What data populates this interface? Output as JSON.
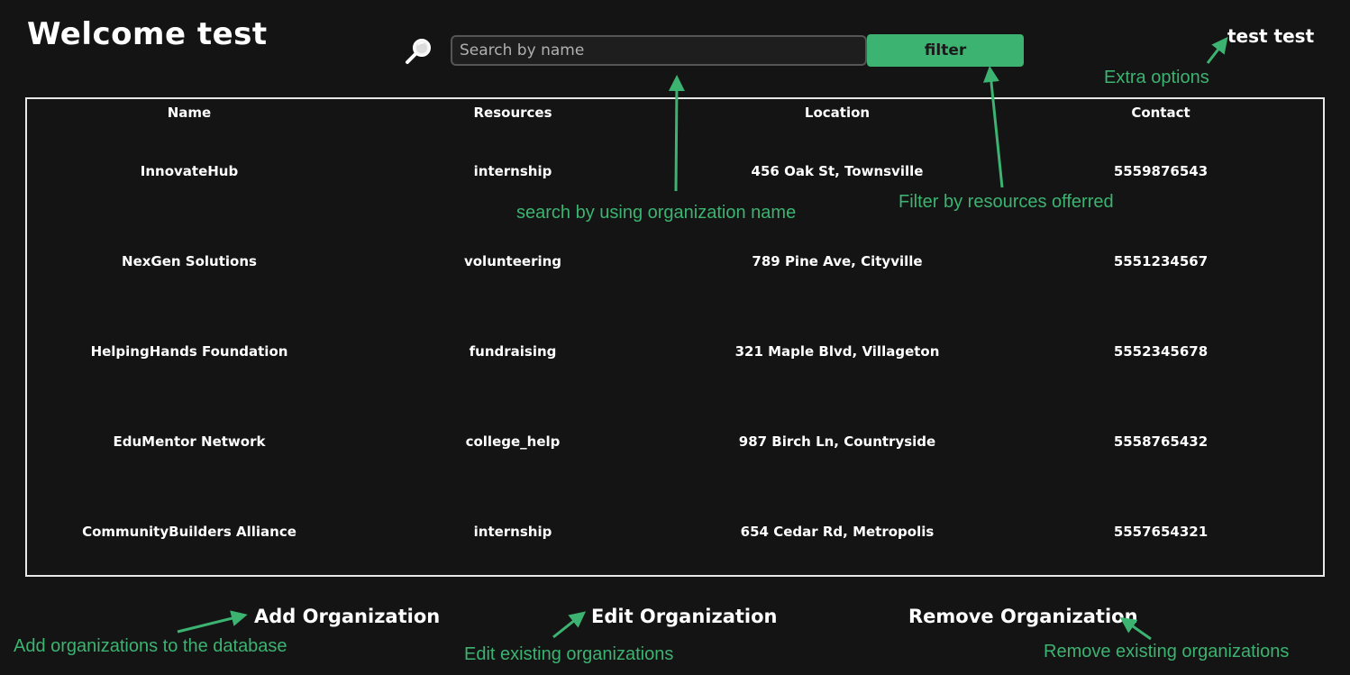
{
  "header": {
    "welcome": "Welcome test",
    "user_name": "test test"
  },
  "search": {
    "placeholder": "Search by name",
    "value": "",
    "filter_label": "filter"
  },
  "table": {
    "columns": [
      "Name",
      "Resources",
      "Location",
      "Contact"
    ],
    "rows": [
      [
        "InnovateHub",
        "internship",
        "456 Oak St, Townsville",
        "5559876543"
      ],
      [
        "NexGen Solutions",
        "volunteering",
        "789 Pine Ave, Cityville",
        "5551234567"
      ],
      [
        "HelpingHands Foundation",
        "fundraising",
        "321 Maple Blvd, Villageton",
        "5552345678"
      ],
      [
        "EduMentor Network",
        "college_help",
        "987 Birch Ln, Countryside",
        "5558765432"
      ],
      [
        "CommunityBuilders Alliance",
        "internship",
        "654 Cedar Rd, Metropolis",
        "5557654321"
      ]
    ]
  },
  "actions": {
    "add": "Add Organization",
    "edit": "Edit Organization",
    "remove": "Remove Organization"
  },
  "annotations": {
    "extra_options": "Extra options",
    "search_hint": "search by using  organization name",
    "filter_hint": "Filter by resources offerred",
    "add_hint": "Add organizations to the database",
    "edit_hint": "Edit existing organizations",
    "remove_hint": "Remove existing organizations"
  },
  "icons": {
    "search": "magnifier-icon"
  },
  "colors": {
    "background": "#141414",
    "accent": "#3cb371",
    "text": "#ffffff",
    "border": "#e8e8e8"
  }
}
